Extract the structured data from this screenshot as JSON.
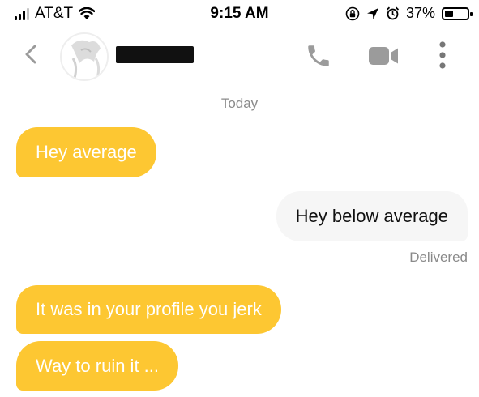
{
  "status_bar": {
    "carrier": "AT&T",
    "time": "9:15 AM",
    "battery_percent": "37%",
    "battery_level": 0.37
  },
  "header": {
    "back_icon": "chevron-left-icon",
    "call_icon": "phone-icon",
    "video_icon": "video-camera-icon",
    "more_icon": "more-vertical-icon"
  },
  "conversation": {
    "day_label": "Today",
    "messages": [
      {
        "direction": "incoming",
        "text": "Hey average"
      },
      {
        "direction": "outgoing",
        "text": "Hey below average"
      },
      {
        "direction": "incoming",
        "text": "It was in your profile you jerk"
      },
      {
        "direction": "incoming",
        "text": "Way to ruin it ..."
      }
    ],
    "receipt": "Delivered"
  },
  "colors": {
    "incoming_bubble": "#fdc732",
    "outgoing_bubble": "#f6f6f6",
    "meta_text": "#8a8a8a",
    "icon_gray": "#9b9b9b"
  }
}
